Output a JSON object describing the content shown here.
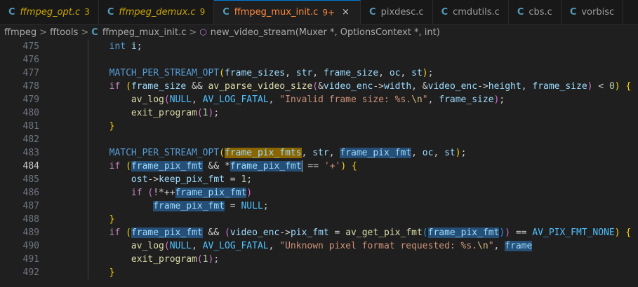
{
  "tabs": [
    {
      "icon": "C",
      "label": "ffmpeg_opt.c",
      "badge": "3",
      "state": "warn"
    },
    {
      "icon": "C",
      "label": "ffmpeg_demux.c",
      "badge": "9",
      "state": "warn"
    },
    {
      "icon": "C",
      "label": "ffmpeg_mux_init.c",
      "badge": "9+",
      "state": "active",
      "close": "×"
    },
    {
      "icon": "C",
      "label": "pixdesc.c",
      "badge": "",
      "state": "normal"
    },
    {
      "icon": "C",
      "label": "cmdutils.c",
      "badge": "",
      "state": "normal"
    },
    {
      "icon": "C",
      "label": "cbs.c",
      "badge": "",
      "state": "normal"
    },
    {
      "icon": "C",
      "label": "vorbisc",
      "badge": "",
      "state": "normal"
    }
  ],
  "breadcrumb": {
    "items": [
      "ffmpeg",
      "fftools",
      "ffmpeg_mux_init.c",
      "new_video_stream(Muxer *, OptionsContext *, int)"
    ],
    "separator": ">",
    "file_icon": "C"
  },
  "editor": {
    "current_line": 484,
    "lines": [
      {
        "n": "475"
      },
      {
        "n": "476"
      },
      {
        "n": "477"
      },
      {
        "n": "478"
      },
      {
        "n": "479"
      },
      {
        "n": "480"
      },
      {
        "n": "481"
      },
      {
        "n": "482"
      },
      {
        "n": "483"
      },
      {
        "n": "484"
      },
      {
        "n": "485"
      },
      {
        "n": "486"
      },
      {
        "n": "487"
      },
      {
        "n": "488"
      },
      {
        "n": "489"
      },
      {
        "n": "490"
      },
      {
        "n": "491"
      },
      {
        "n": "492"
      }
    ]
  },
  "colors": {
    "tab_active_text": "#ff8a3d",
    "tab_warn_text": "#cca700",
    "c_icon": "#519aba",
    "keyword": "#569cd6",
    "function": "#dcdcaa",
    "string": "#ce9178",
    "highlight": "#264f78",
    "word_highlight": "#8a6500"
  }
}
